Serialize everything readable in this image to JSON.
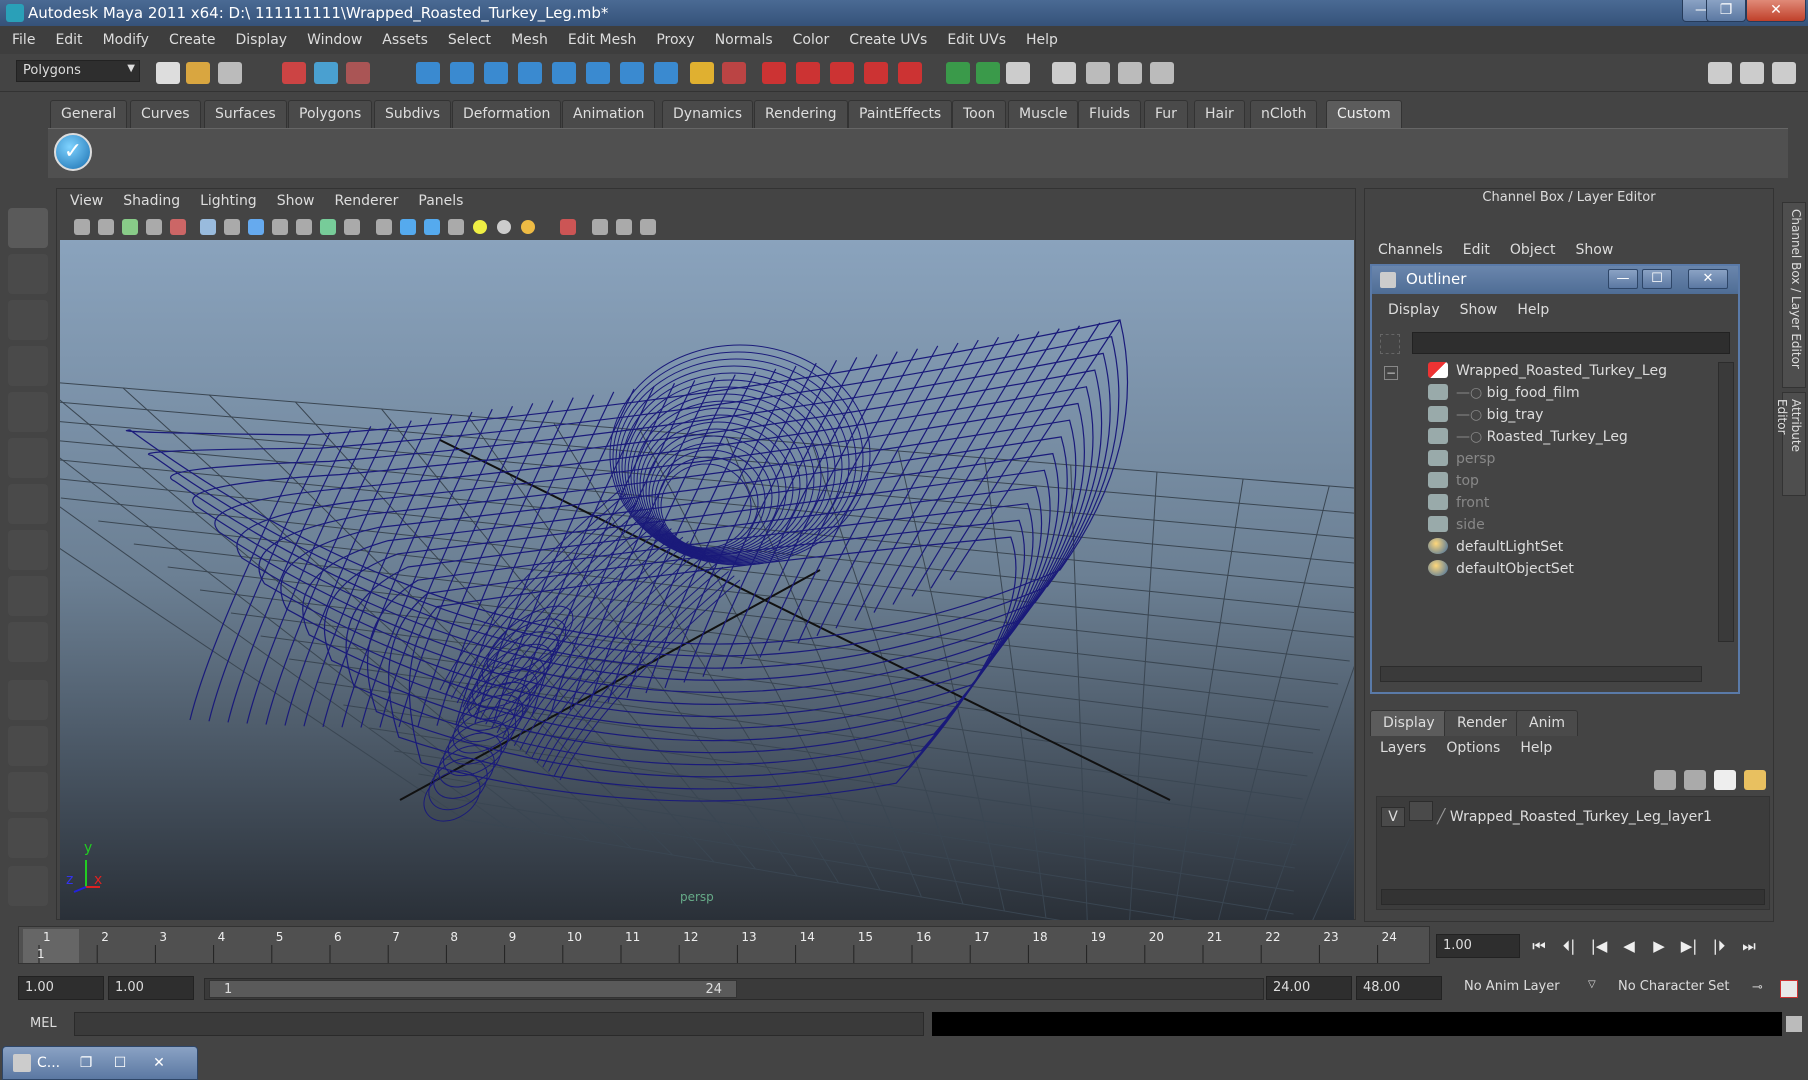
{
  "window": {
    "title": "Autodesk Maya 2011 x64: D:\\ 111111111\\Wrapped_Roasted_Turkey_Leg.mb*",
    "minimize": "—",
    "maximize": "❐",
    "close": "✕"
  },
  "menubar": [
    "File",
    "Edit",
    "Modify",
    "Create",
    "Display",
    "Window",
    "Assets",
    "Select",
    "Mesh",
    "Edit Mesh",
    "Proxy",
    "Normals",
    "Color",
    "Create UVs",
    "Edit UVs",
    "Help"
  ],
  "statusline": {
    "mode": "Polygons"
  },
  "shelf": {
    "tabs": [
      "General",
      "Curves",
      "Surfaces",
      "Polygons",
      "Subdivs",
      "Deformation",
      "Animation",
      "Dynamics",
      "Rendering",
      "PaintEffects",
      "Toon",
      "Muscle",
      "Fluids",
      "Fur",
      "Hair",
      "nCloth",
      "Custom"
    ],
    "active": "Custom",
    "button_glyph": "✓"
  },
  "viewport": {
    "menu": [
      "View",
      "Shading",
      "Lighting",
      "Show",
      "Renderer",
      "Panels"
    ],
    "camera": "persp",
    "axis_x": "x",
    "axis_y": "y",
    "axis_z": "z"
  },
  "channelbox": {
    "title": "Channel Box / Layer Editor",
    "menu": [
      "Channels",
      "Edit",
      "Object",
      "Show"
    ],
    "side_tabs": [
      "Channel Box / Layer Editor",
      "Attribute Editor"
    ]
  },
  "outliner": {
    "title": "Outliner",
    "minimize": "—",
    "maximize": "☐",
    "close": "✕",
    "menu": [
      "Display",
      "Show",
      "Help"
    ],
    "expand_glyph": "−",
    "items": [
      {
        "label": "Wrapped_Roasted_Turkey_Leg",
        "icon": "transform-icon",
        "indent": 0,
        "dim": false
      },
      {
        "label": "big_food_film",
        "icon": "mesh-icon",
        "indent": 1,
        "dim": false
      },
      {
        "label": "big_tray",
        "icon": "mesh-icon",
        "indent": 1,
        "dim": false
      },
      {
        "label": "Roasted_Turkey_Leg",
        "icon": "mesh-icon",
        "indent": 1,
        "dim": false
      },
      {
        "label": "persp",
        "icon": "camera-icon",
        "indent": 0,
        "dim": true
      },
      {
        "label": "top",
        "icon": "camera-icon",
        "indent": 0,
        "dim": true
      },
      {
        "label": "front",
        "icon": "camera-icon",
        "indent": 0,
        "dim": true
      },
      {
        "label": "side",
        "icon": "camera-icon",
        "indent": 0,
        "dim": true
      },
      {
        "label": "defaultLightSet",
        "icon": "set-icon",
        "indent": 0,
        "dim": false
      },
      {
        "label": "defaultObjectSet",
        "icon": "set-icon",
        "indent": 0,
        "dim": false
      }
    ]
  },
  "layers": {
    "tabs": [
      "Display",
      "Render",
      "Anim"
    ],
    "active": "Display",
    "menu": [
      "Layers",
      "Options",
      "Help"
    ],
    "visible_flag": "V",
    "layer_name": "Wrapped_Roasted_Turkey_Leg_layer1"
  },
  "timeline": {
    "ticks": [
      "1",
      "2",
      "3",
      "4",
      "5",
      "6",
      "7",
      "8",
      "9",
      "10",
      "11",
      "12",
      "13",
      "14",
      "15",
      "16",
      "17",
      "18",
      "19",
      "20",
      "21",
      "22",
      "23",
      "24"
    ],
    "current_marker": "1",
    "current_frame": "1.00"
  },
  "playback": [
    "⏮",
    "⏴|",
    "|◀",
    "◀",
    "▶",
    "▶|",
    "|⏵",
    "⏭"
  ],
  "range": {
    "start": "1.00",
    "playback_start": "1.00",
    "thumb_start": "1",
    "thumb_end": "24",
    "playback_end": "24.00",
    "end": "48.00",
    "anim_layer": "No Anim Layer",
    "character_set": "No Character Set"
  },
  "cmdline": {
    "label": "MEL"
  },
  "taskwin": {
    "label": "C...",
    "restore": "❐",
    "maximize": "☐",
    "close": "✕"
  },
  "colors": {
    "wireframe": "#1a1a7a",
    "grid": "#3a4652",
    "accent": "#5a7aa8"
  }
}
